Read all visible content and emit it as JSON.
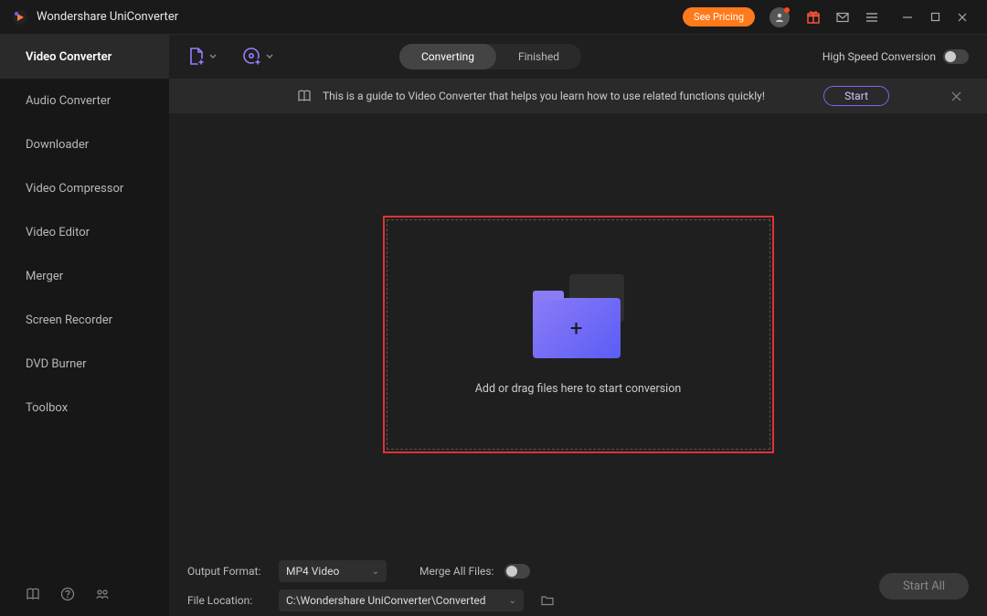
{
  "header": {
    "title": "Wondershare UniConverter",
    "see_pricing": "See Pricing"
  },
  "sidebar": {
    "items": [
      {
        "label": "Video Converter"
      },
      {
        "label": "Audio Converter"
      },
      {
        "label": "Downloader"
      },
      {
        "label": "Video Compressor"
      },
      {
        "label": "Video Editor"
      },
      {
        "label": "Merger"
      },
      {
        "label": "Screen Recorder"
      },
      {
        "label": "DVD Burner"
      },
      {
        "label": "Toolbox"
      }
    ]
  },
  "toolbar": {
    "tabs": {
      "converting": "Converting",
      "finished": "Finished"
    },
    "high_speed_label": "High Speed Conversion"
  },
  "guide": {
    "text": "This is a guide to Video Converter that helps you learn how to use related functions quickly!",
    "start": "Start"
  },
  "dropzone": {
    "text": "Add or drag files here to start conversion"
  },
  "bottom": {
    "output_format_label": "Output Format:",
    "output_format_value": "MP4 Video",
    "merge_label": "Merge All Files:",
    "file_location_label": "File Location:",
    "file_location_value": "C:\\Wondershare UniConverter\\Converted",
    "start_all": "Start All"
  }
}
